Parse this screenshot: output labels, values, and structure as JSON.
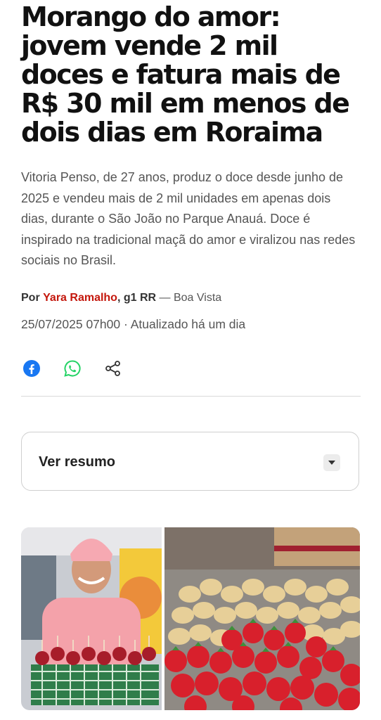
{
  "article": {
    "headline": "Morango do amor: jovem vende 2 mil doces e fatura mais de R$ 30 mil em menos de dois dias em Roraima",
    "subtitle": "Vitoria Penso, de 27 anos, produz o doce desde junho de 2025 e vendeu mais de 2 mil unidades em apenas dois dias, durante o São João no Parque Anauá. Doce é inspirado na tradicional maçã do amor e viralizou nas redes sociais no Brasil.",
    "byline": {
      "prefix": "Por",
      "author": "Yara Ramalho",
      "outlet": ", g1 RR",
      "location": " — Boa Vista"
    },
    "dateline": "25/07/2025 07h00 · Atualizado há um dia"
  },
  "share": {
    "icons": [
      "facebook-icon",
      "whatsapp-icon",
      "share-icon"
    ],
    "colors": {
      "facebook": "#1877f2",
      "whatsapp": "#25d366",
      "share": "#333333"
    }
  },
  "summary": {
    "label": "Ver resumo"
  },
  "colors": {
    "author": "#c4170c",
    "text": "#111111",
    "muted": "#555555"
  }
}
